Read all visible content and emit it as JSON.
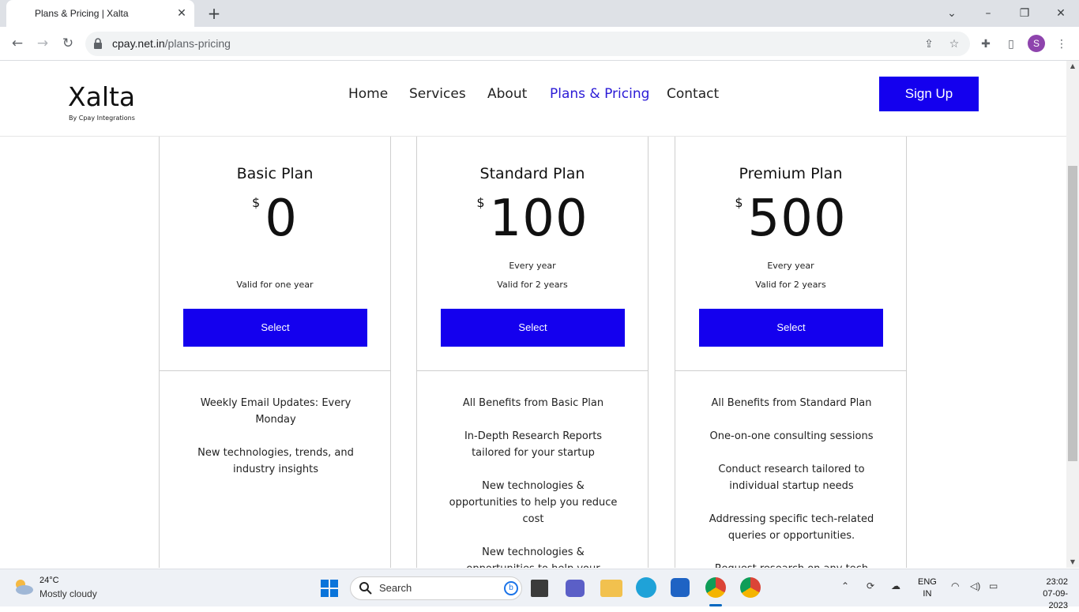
{
  "browser": {
    "tab_title": "Plans & Pricing | Xalta",
    "tab_close": "✕",
    "new_tab": "+",
    "url_host": "cpay.net.in",
    "url_path": "/plans-pricing",
    "profile_initial": "S"
  },
  "site": {
    "logo": "Xalta",
    "logo_sub": "By Cpay Integrations",
    "nav": [
      "Home",
      "Services",
      "About",
      "Plans & Pricing",
      "Contact"
    ],
    "active_nav": "Plans & Pricing",
    "signup": "Sign Up"
  },
  "plans": [
    {
      "name": "Basic Plan",
      "currency": "$",
      "price": "0",
      "every": "",
      "valid": "Valid for one year",
      "button": "Select",
      "features": [
        "Weekly Email Updates: Every Monday",
        "New technologies, trends, and industry insights"
      ]
    },
    {
      "name": "Standard Plan",
      "currency": "$",
      "price": "100",
      "every": "Every year",
      "valid": "Valid for 2 years",
      "button": "Select",
      "features": [
        "All Benefits from Basic Plan",
        "In-Depth Research Reports tailored for your startup",
        "New technologies & opportunities to help you reduce cost",
        "New technologies & opportunities to help your startup grow"
      ]
    },
    {
      "name": "Premium Plan",
      "currency": "$",
      "price": "500",
      "every": "Every year",
      "valid": "Valid for 2 years",
      "button": "Select",
      "features": [
        "All Benefits from Standard Plan",
        "One-on-one consulting sessions",
        "Conduct research tailored to individual startup needs",
        "Addressing specific tech-related queries or opportunities.",
        "Request research on any tech topic"
      ]
    }
  ],
  "taskbar": {
    "temperature": "24°C",
    "weather": "Mostly cloudy",
    "search": "Search",
    "lang_top": "ENG",
    "lang_bottom": "IN",
    "time": "23:02",
    "date": "07-09-2023"
  },
  "colors": {
    "accent": "#1400ee",
    "nav_active": "#2b1bd6"
  }
}
